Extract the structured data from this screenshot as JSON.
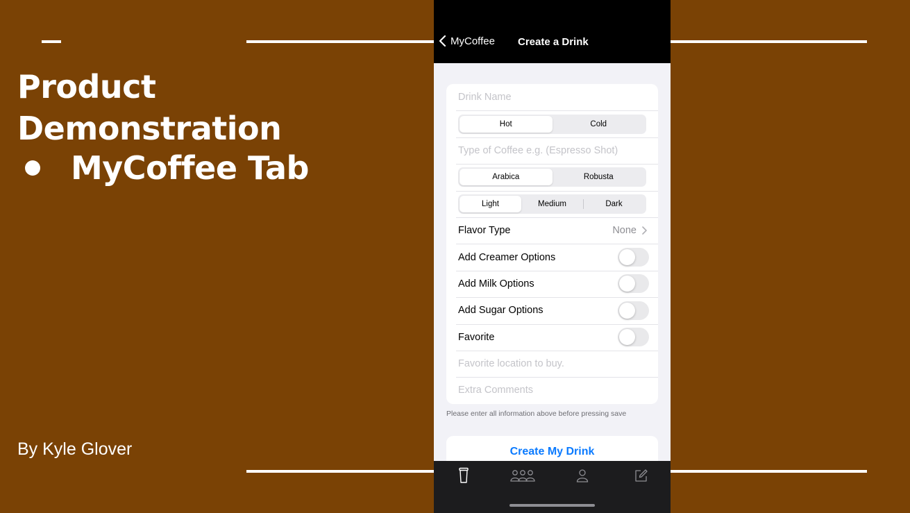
{
  "slide": {
    "title_line1": "Product",
    "title_line2": "Demonstration",
    "bullet": "MyCoffee Tab",
    "author": "By Kyle Glover"
  },
  "colors": {
    "slide_background": "#7a4205",
    "accent_blue": "#0a7aff",
    "navbar": "#000000",
    "tabbar": "#1c1c1e"
  },
  "nav": {
    "back_label": "MyCoffee",
    "title": "Create a Drink",
    "back_icon": "chevron-left-icon"
  },
  "form": {
    "drink_name_placeholder": "Drink Name",
    "temperature": {
      "options": [
        "Hot",
        "Cold"
      ],
      "selected": "Hot"
    },
    "coffee_type_placeholder": "Type of Coffee e.g. (Espresso Shot)",
    "bean": {
      "options": [
        "Arabica",
        "Robusta"
      ],
      "selected": "Arabica"
    },
    "roast": {
      "options": [
        "Light",
        "Medium",
        "Dark"
      ],
      "selected": "Light"
    },
    "flavor": {
      "label": "Flavor Type",
      "value": "None"
    },
    "toggles": [
      {
        "label": "Add Creamer Options",
        "on": false
      },
      {
        "label": "Add Milk Options",
        "on": false
      },
      {
        "label": "Add Sugar Options",
        "on": false
      },
      {
        "label": "Favorite",
        "on": false
      }
    ],
    "favorite_location_placeholder": "Favorite location to buy.",
    "comments_placeholder": "Extra Comments",
    "helper_text": "Please enter all information above before pressing save",
    "create_button": "Create My Drink"
  },
  "tabbar": {
    "items": [
      {
        "icon": "cup-icon"
      },
      {
        "icon": "group-icon"
      },
      {
        "icon": "person-icon"
      },
      {
        "icon": "compose-icon"
      }
    ]
  }
}
